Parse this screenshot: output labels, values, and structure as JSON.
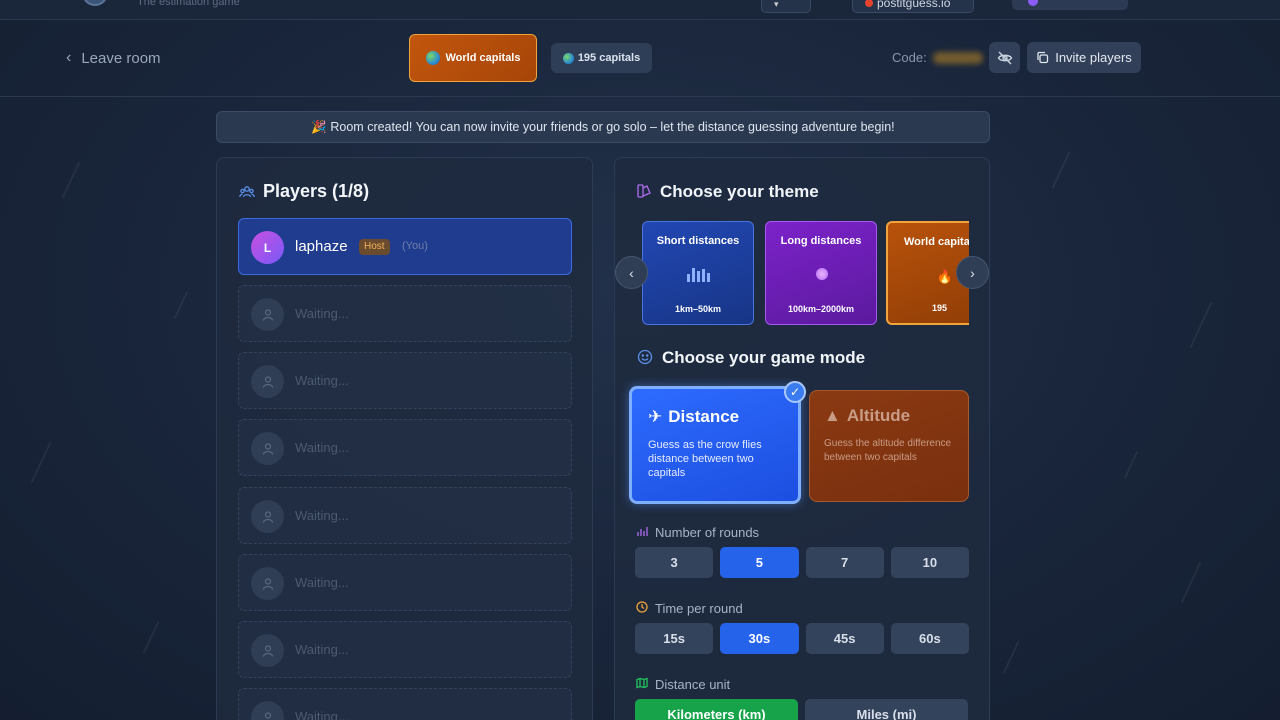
{
  "topbar": {
    "tagline": "The estimation game",
    "site": "postitguess.io"
  },
  "header": {
    "leave_label": "Leave room",
    "theme_chip": "World capitals",
    "count_chip": "195 capitals",
    "code_label": "Code:",
    "invite_label": "Invite players"
  },
  "banner": {
    "text": "🎉 Room created! You can now invite your friends or go solo – let the distance guessing adventure begin!"
  },
  "players": {
    "title": "Players (1/8)",
    "host": {
      "initial": "L",
      "name": "laphaze",
      "badge": "Host",
      "you": "(You)"
    },
    "waiting_label": "Waiting..."
  },
  "theme": {
    "title": "Choose your theme",
    "cards": [
      {
        "name": "Short distances",
        "sub": "1km–50km"
      },
      {
        "name": "Long distances",
        "sub": "100km–2000km"
      },
      {
        "name": "World capitals",
        "sub": "195"
      }
    ]
  },
  "mode": {
    "title": "Choose your game mode",
    "distance": {
      "title": "Distance",
      "desc": "Guess as the crow flies distance between two capitals"
    },
    "altitude": {
      "title": "Altitude",
      "desc": "Guess the altitude difference between two capitals"
    }
  },
  "rounds": {
    "label": "Number of rounds",
    "options": [
      "3",
      "5",
      "7",
      "10"
    ],
    "selected": "5"
  },
  "time": {
    "label": "Time per round",
    "options": [
      "15s",
      "30s",
      "45s",
      "60s"
    ],
    "selected": "30s"
  },
  "unit": {
    "label": "Distance unit",
    "options": [
      "Kilometers (km)",
      "Miles (mi)"
    ],
    "selected": "Kilometers (km)"
  },
  "colors": {
    "accent_blue": "#2563eb",
    "accent_green": "#16a34a",
    "accent_orange": "#f0a43a"
  }
}
